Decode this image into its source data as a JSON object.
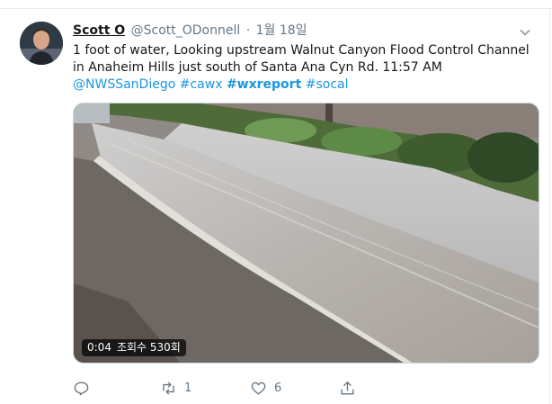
{
  "tweet": {
    "display_name": "Scott O",
    "handle": "@Scott_ODonnell",
    "separator": "·",
    "timestamp": "1월 18일",
    "text_line1": "1 foot of water, Looking upstream Walnut Canyon Flood Control Channel",
    "text_line2": "in Anaheim Hills just south of Santa Ana Cyn Rd. 11:57 AM",
    "mentions_hashtags": [
      {
        "text": "@NWSSanDiego",
        "bold": false
      },
      {
        "text": "#cawx",
        "bold": false
      },
      {
        "text": "#wxreport",
        "bold": true
      },
      {
        "text": "#socal",
        "bold": false
      }
    ],
    "video": {
      "duration": "0:04",
      "views": "조회수 530회"
    },
    "actions": {
      "reply_count": "",
      "retweet_count": "1",
      "like_count": "6",
      "share_count": ""
    },
    "icons": {
      "avatar": "profile-photo",
      "caret": "chevron-down-icon",
      "reply": "reply-icon",
      "retweet": "retweet-icon",
      "like": "heart-icon",
      "share": "share-icon"
    }
  },
  "colors": {
    "link": "#1b95e0",
    "muted": "#657786",
    "text": "#14171a",
    "border": "#e6ecf0"
  }
}
